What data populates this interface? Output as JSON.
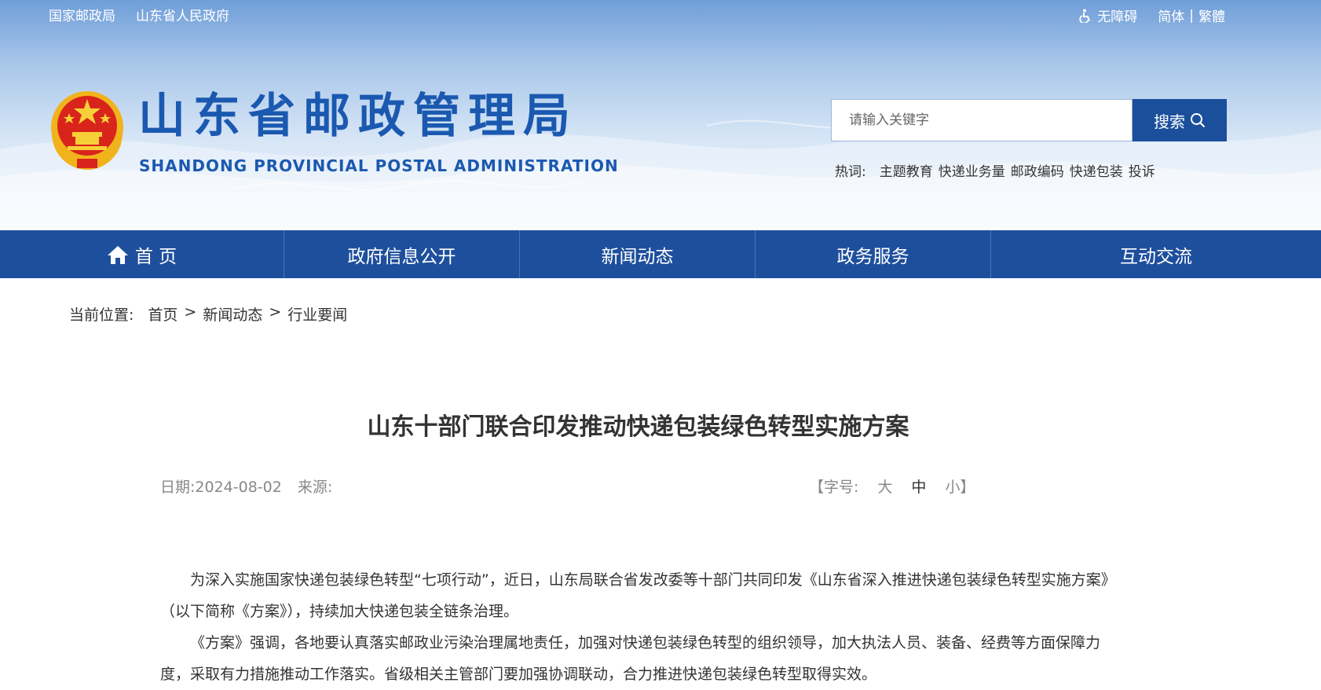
{
  "topbar": {
    "links": [
      "国家邮政局",
      "山东省人民政府"
    ],
    "accessibility": "无障碍",
    "lang_simplified": "简体",
    "lang_sep": "|",
    "lang_traditional": "繁體"
  },
  "brand": {
    "title": "山东省邮政管理局",
    "subtitle": "SHANDONG PROVINCIAL POSTAL ADMINISTRATION"
  },
  "search": {
    "placeholder": "请输入关键字",
    "button_label": "搜索"
  },
  "hotwords": {
    "label": "热词:",
    "items": [
      "主题教育",
      "快递业务量",
      "邮政编码",
      "快递包装",
      "投诉"
    ]
  },
  "nav": {
    "items": [
      {
        "label": "首 页"
      },
      {
        "label": "政府信息公开"
      },
      {
        "label": "新闻动态"
      },
      {
        "label": "政务服务"
      },
      {
        "label": "互动交流"
      }
    ]
  },
  "breadcrumb": {
    "label": "当前位置:",
    "items": [
      "首页",
      "新闻动态",
      "行业要闻"
    ],
    "sep": ">"
  },
  "article": {
    "title": "山东十部门联合印发推动快递包装绿色转型实施方案",
    "date_label": "日期:",
    "date": "2024-08-02",
    "source_label": "来源:",
    "fontsize_prefix": "【字号:",
    "fontsize_large": "大",
    "fontsize_medium": "中",
    "fontsize_small": "小】",
    "paragraphs": [
      "为深入实施国家快递包装绿色转型“七项行动”，近日，山东局联合省发改委等十部门共同印发《山东省深入推进快递包装绿色转型实施方案》（以下简称《方案》），持续加大快递包装全链条治理。",
      "《方案》强调，各地要认真落实邮政业污染治理属地责任，加强对快递包装绿色转型的组织领导，加大执法人员、装备、经费等方面保障力度，采取有力措施推动工作落实。省级相关主管部门要加强协调联动，合力推进快递包装绿色转型取得实效。"
    ]
  },
  "colors": {
    "brand_blue": "#1b59b0",
    "nav_blue": "#1e4f9d",
    "search_btn": "#1b4f9c"
  }
}
